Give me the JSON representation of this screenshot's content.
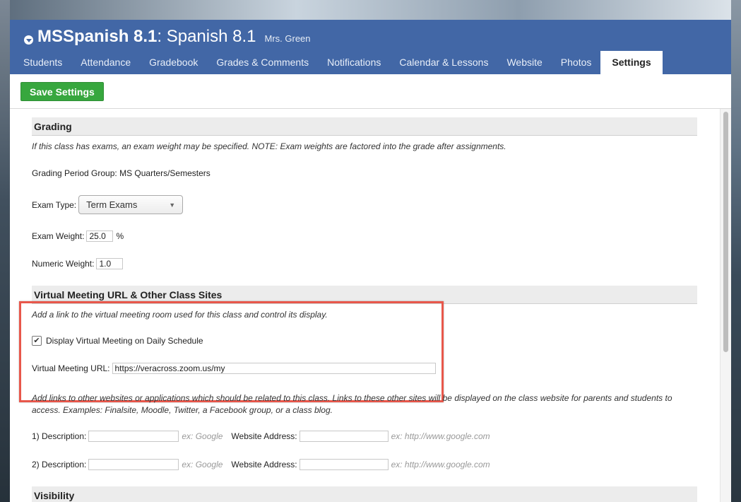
{
  "header": {
    "class_code": "MSSpanish 8.1",
    "class_name": ": Spanish 8.1",
    "teacher": "Mrs. Green"
  },
  "tabs": [
    {
      "label": "Students"
    },
    {
      "label": "Attendance"
    },
    {
      "label": "Gradebook"
    },
    {
      "label": "Grades & Comments"
    },
    {
      "label": "Notifications"
    },
    {
      "label": "Calendar & Lessons"
    },
    {
      "label": "Website"
    },
    {
      "label": "Photos"
    },
    {
      "label": "Settings",
      "active": true
    }
  ],
  "toolbar": {
    "save_label": "Save Settings"
  },
  "grading": {
    "title": "Grading",
    "note": "If this class has exams, an exam weight may be specified. NOTE: Exam weights are factored into the grade after assignments.",
    "period_group": "Grading Period Group: MS Quarters/Semesters",
    "exam_type_label": "Exam Type:",
    "exam_type_value": "Term Exams",
    "exam_weight_label": "Exam Weight:",
    "exam_weight_value": "25.0",
    "exam_weight_unit": "%",
    "numeric_weight_label": "Numeric Weight:",
    "numeric_weight_value": "1.0"
  },
  "virtual": {
    "title": "Virtual Meeting URL & Other Class Sites",
    "note": "Add a link to the virtual meeting room used for this class and control its display.",
    "display_label": "Display Virtual Meeting on Daily Schedule",
    "display_checked": true,
    "url_label": "Virtual Meeting URL:",
    "url_value": "https://veracross.zoom.us/my"
  },
  "other_sites": {
    "note": "Add links to other websites or applications which should be related to this class. Links to these other sites will be displayed on the class website for parents and students to access. Examples: Finalsite, Moodle, Twitter, a Facebook group, or a class blog.",
    "rows": [
      {
        "desc_label": "1) Description:",
        "desc_hint": "ex: Google",
        "addr_label": "Website Address:",
        "addr_hint": "ex: http://www.google.com"
      },
      {
        "desc_label": "2) Description:",
        "desc_hint": "ex: Google",
        "addr_label": "Website Address:",
        "addr_hint": "ex: http://www.google.com"
      }
    ]
  },
  "visibility": {
    "title": "Visibility"
  },
  "colors": {
    "header": "#4267a6",
    "save_button": "#37a73e",
    "highlight": "#e8574b"
  }
}
